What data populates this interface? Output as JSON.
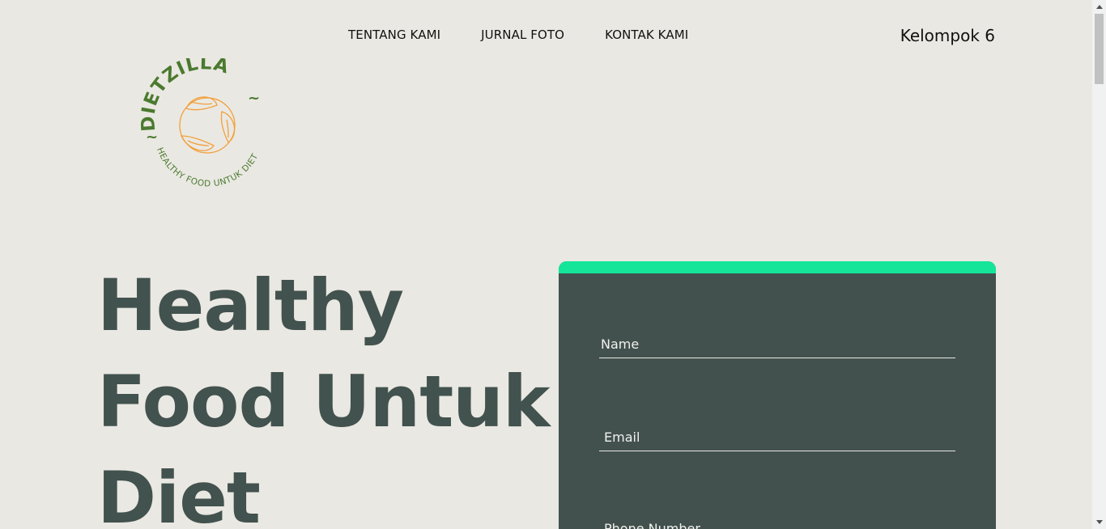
{
  "nav": {
    "items": [
      "TENTANG KAMI",
      "JURNAL FOTO",
      "KONTAK KAMI"
    ]
  },
  "brand": {
    "group": "Kelompok 6",
    "logo_name": "DIETZILLA",
    "logo_tagline": "HEALTHY FOOD UNTUK DIET"
  },
  "hero": {
    "lines": [
      "Healthy",
      "Food Untuk",
      "Diet"
    ]
  },
  "form": {
    "name_placeholder": "Name",
    "email_placeholder": "Email",
    "phone_placeholder": "Phone Number"
  },
  "colors": {
    "background": "#EAE8E3",
    "heading": "#42524E",
    "card": "#42514E",
    "accent": "#14E599",
    "logo_green": "#4A7A2E",
    "logo_orange": "#F2A03A"
  },
  "icons": {
    "logo": "dietzilla-logo",
    "scroll_up": "chevron-up-icon",
    "scroll_down": "chevron-down-icon"
  }
}
